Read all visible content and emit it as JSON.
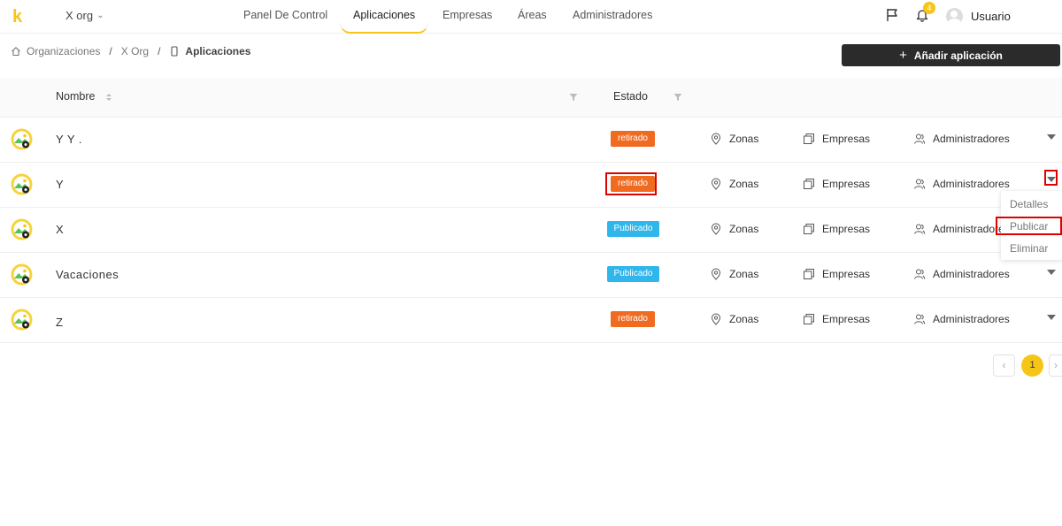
{
  "header": {
    "logo": "k",
    "org_selector": "X org",
    "nav": [
      "Panel De Control",
      "Aplicaciones",
      "Empresas",
      "Áreas",
      "Administradores"
    ],
    "notifications_count": "4",
    "user_name": "Usuario"
  },
  "breadcrumb": {
    "items": [
      "Organizaciones",
      "X Org",
      "Aplicaciones"
    ]
  },
  "toolbar": {
    "add_label": "Añadir aplicación"
  },
  "table": {
    "columns": {
      "name": "Nombre",
      "status": "Estado"
    },
    "link_labels": {
      "zones": "Zonas",
      "companies": "Empresas",
      "admins": "Administradores"
    },
    "rows": [
      {
        "name": "Y Y .",
        "status": "retirado",
        "status_type": "retired"
      },
      {
        "name": "Y",
        "status": "retirado",
        "status_type": "retired"
      },
      {
        "name": "X",
        "status": "Publicado",
        "status_type": "published"
      },
      {
        "name": "Vacaciones",
        "status": "Publicado",
        "status_type": "published"
      },
      {
        "name": "Z",
        "status": "retirado",
        "status_type": "retired"
      }
    ]
  },
  "row_menu": {
    "items": [
      "Detalles",
      "Publicar",
      "Eliminar"
    ]
  },
  "pagination": {
    "current_page": "1",
    "prev": "‹",
    "next": "›"
  },
  "colors": {
    "accent": "#f5c518",
    "retired": "#f06a20",
    "published": "#2fb6ea",
    "highlight": "#e00000"
  }
}
